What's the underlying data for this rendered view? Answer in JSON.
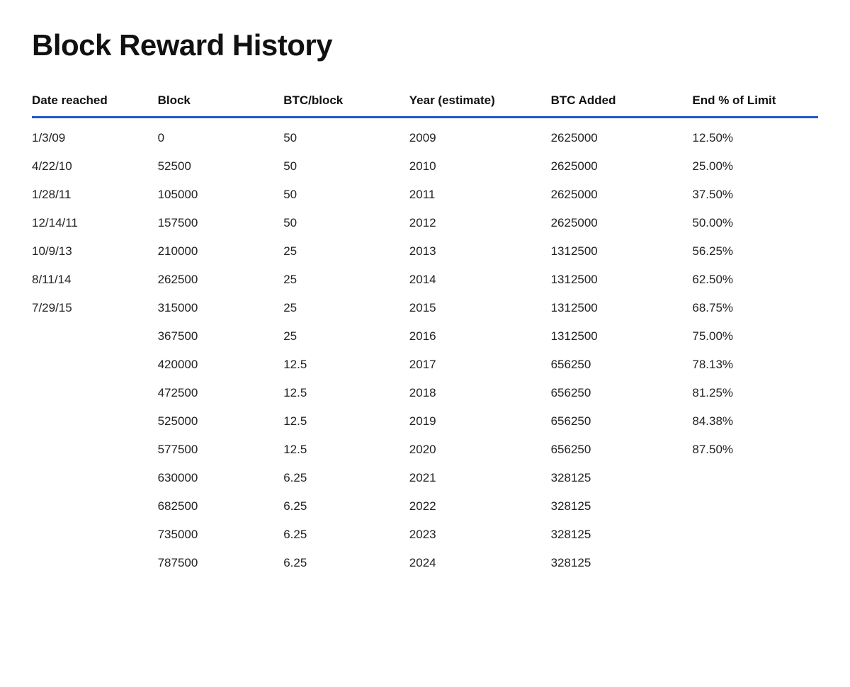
{
  "page": {
    "title": "Block Reward History"
  },
  "table": {
    "headers": {
      "date": "Date reached",
      "block": "Block",
      "btcblock": "BTC/block",
      "year": "Year (estimate)",
      "btcadded": "BTC Added",
      "endlimit": "End % of Limit"
    },
    "rows": [
      {
        "date": "1/3/09",
        "block": "0",
        "btcblock": "50",
        "year": "2009",
        "btcadded": "2625000",
        "endlimit": "12.50%"
      },
      {
        "date": "4/22/10",
        "block": "52500",
        "btcblock": "50",
        "year": "2010",
        "btcadded": "2625000",
        "endlimit": "25.00%"
      },
      {
        "date": "1/28/11",
        "block": "105000",
        "btcblock": "50",
        "year": "2011",
        "btcadded": "2625000",
        "endlimit": "37.50%"
      },
      {
        "date": "12/14/11",
        "block": "157500",
        "btcblock": "50",
        "year": "2012",
        "btcadded": "2625000",
        "endlimit": "50.00%"
      },
      {
        "date": "10/9/13",
        "block": "210000",
        "btcblock": "25",
        "year": "2013",
        "btcadded": "1312500",
        "endlimit": "56.25%"
      },
      {
        "date": "8/11/14",
        "block": "262500",
        "btcblock": "25",
        "year": "2014",
        "btcadded": "1312500",
        "endlimit": "62.50%"
      },
      {
        "date": "7/29/15",
        "block": "315000",
        "btcblock": "25",
        "year": "2015",
        "btcadded": "1312500",
        "endlimit": "68.75%"
      },
      {
        "date": "",
        "block": "367500",
        "btcblock": "25",
        "year": "2016",
        "btcadded": "1312500",
        "endlimit": "75.00%"
      },
      {
        "date": "",
        "block": "420000",
        "btcblock": "12.5",
        "year": "2017",
        "btcadded": "656250",
        "endlimit": "78.13%"
      },
      {
        "date": "",
        "block": "472500",
        "btcblock": "12.5",
        "year": "2018",
        "btcadded": "656250",
        "endlimit": "81.25%"
      },
      {
        "date": "",
        "block": "525000",
        "btcblock": "12.5",
        "year": "2019",
        "btcadded": "656250",
        "endlimit": "84.38%"
      },
      {
        "date": "",
        "block": "577500",
        "btcblock": "12.5",
        "year": "2020",
        "btcadded": "656250",
        "endlimit": "87.50%"
      },
      {
        "date": "",
        "block": "630000",
        "btcblock": "6.25",
        "year": "2021",
        "btcadded": "328125",
        "endlimit": ""
      },
      {
        "date": "",
        "block": "682500",
        "btcblock": "6.25",
        "year": "2022",
        "btcadded": "328125",
        "endlimit": ""
      },
      {
        "date": "",
        "block": "735000",
        "btcblock": "6.25",
        "year": "2023",
        "btcadded": "328125",
        "endlimit": ""
      },
      {
        "date": "",
        "block": "787500",
        "btcblock": "6.25",
        "year": "2024",
        "btcadded": "328125",
        "endlimit": ""
      }
    ]
  }
}
